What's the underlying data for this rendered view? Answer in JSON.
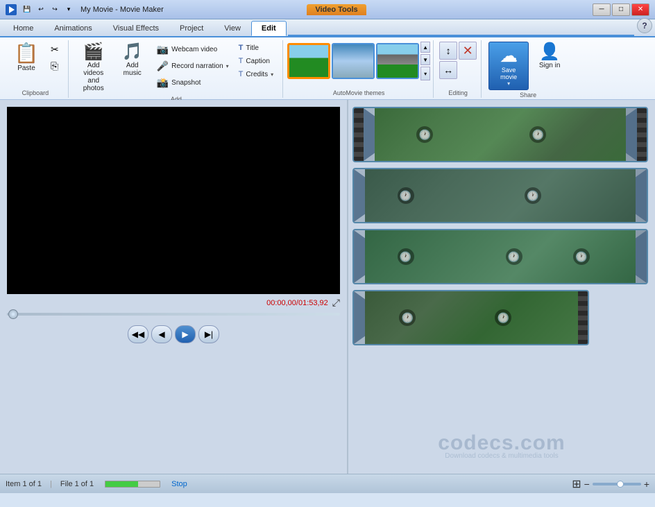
{
  "titlebar": {
    "app_title": "My Movie - Movie Maker",
    "video_tools_label": "Video Tools",
    "min_btn": "─",
    "max_btn": "□",
    "close_btn": "✕"
  },
  "ribbon": {
    "tabs": [
      {
        "label": "Home",
        "active": true
      },
      {
        "label": "Animations"
      },
      {
        "label": "Visual Effects"
      },
      {
        "label": "Project"
      },
      {
        "label": "View"
      },
      {
        "label": "Edit",
        "style": "edit"
      }
    ],
    "groups": {
      "clipboard": {
        "label": "Clipboard",
        "paste_label": "Paste"
      },
      "add": {
        "label": "Add",
        "add_videos_label": "Add videos\nand photos",
        "add_music_label": "Add\nmusic",
        "webcam_label": "Webcam video",
        "record_narration_label": "Record narration",
        "snapshot_label": "Snapshot",
        "title_label": "Title",
        "caption_label": "Caption",
        "credits_label": "Credits"
      },
      "automovie": {
        "label": "AutoMovie themes"
      },
      "editing": {
        "label": "Editing"
      },
      "share": {
        "label": "Share",
        "save_movie_label": "Save\nmovie",
        "sign_in_label": "Sign\nin"
      }
    }
  },
  "preview": {
    "time_current": "00:00,00",
    "time_total": "01:53,92"
  },
  "timeline": {
    "strips": [
      {
        "type": "waterfall",
        "has_arrows": true,
        "clocks": [
          1,
          4
        ]
      },
      {
        "type": "waterfall",
        "has_arrows": true,
        "clocks": [
          1,
          4
        ]
      },
      {
        "type": "waterfall",
        "has_arrows": true,
        "clocks": [
          1,
          4
        ]
      },
      {
        "type": "waterfall",
        "has_arrows": false,
        "clocks": [
          1,
          4
        ]
      }
    ]
  },
  "watermark": {
    "text": "codecs.com",
    "subtext": "Download codecs & multimedia tools"
  },
  "statusbar": {
    "item_label": "Item 1 of 1",
    "file_label": "File 1 of 1",
    "stop_label": "Stop",
    "view_toggle": "⊞"
  },
  "controls": {
    "prev": "◀◀",
    "rewind": "◀",
    "play": "▶",
    "next": "▶|"
  }
}
